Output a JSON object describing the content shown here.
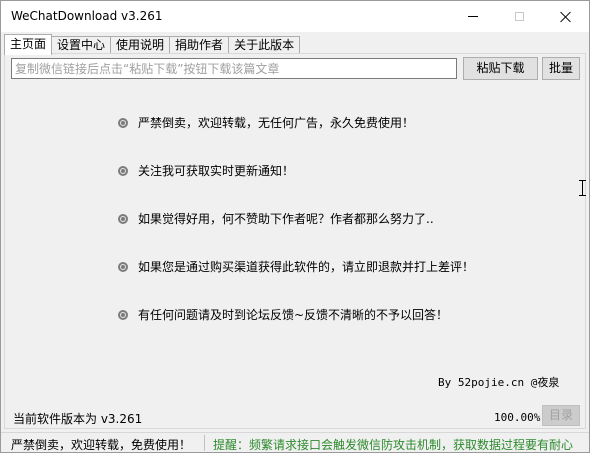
{
  "window": {
    "title": "WeChatDownload v3.261"
  },
  "tabs": [
    {
      "label": "主页面",
      "active": true
    },
    {
      "label": "设置中心",
      "active": false
    },
    {
      "label": "使用说明",
      "active": false
    },
    {
      "label": "捐助作者",
      "active": false
    },
    {
      "label": "关于此版本",
      "active": false
    }
  ],
  "main": {
    "url_input": {
      "value": "",
      "placeholder": "复制微信链接后点击“粘贴下载”按钮下载该篇文章"
    },
    "paste_button_label": "粘贴下载",
    "batch_button_label": "批量",
    "notices": [
      "严禁倒卖，欢迎转载，无任何广告，永久免费使用！",
      "关注我可获取实时更新通知！",
      "如果觉得好用，何不赞助下作者呢？作者都那么努力了..",
      "如果您是通过购买渠道获得此软件的，请立即退款并打上差评！",
      "有任何问题请及时到论坛反馈~反馈不清晰的不予以回答！"
    ],
    "author": "By 52pojie.cn @夜泉",
    "version_label": "当前软件版本为 v3.261",
    "progress": "100.00%",
    "dir_button_label": "目录"
  },
  "statusbar": {
    "left": "严禁倒卖，欢迎转载，免费使用！",
    "right": "提醒：频繁请求接口会触发微信防攻击机制，获取数据过程要有耐心",
    "right_color": "#2d8a2d"
  }
}
